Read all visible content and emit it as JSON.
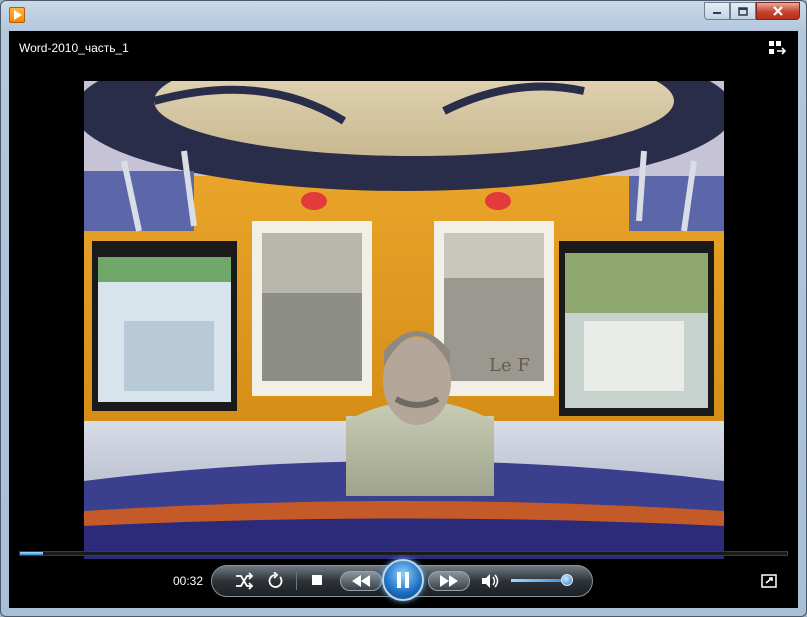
{
  "window": {
    "title": "Word-2010_часть_1"
  },
  "icons": {
    "app": "media-player-icon",
    "minimize": "minimize-icon",
    "maximize": "maximize-icon",
    "close": "close-icon",
    "switch": "switch-to-library-icon",
    "shuffle": "shuffle-icon",
    "repeat": "repeat-icon",
    "stop": "stop-icon",
    "previous": "previous-icon",
    "pause": "pause-icon",
    "next": "next-icon",
    "volume": "volume-icon",
    "fullscreen": "fullscreen-icon"
  },
  "player": {
    "elapsed": "00:32",
    "progress_fraction": 0.03,
    "volume_fraction": 0.9,
    "state": "playing"
  },
  "colors": {
    "accent": "#2b8ad0",
    "window_frame": "#b3c7dc",
    "background": "#000000"
  }
}
